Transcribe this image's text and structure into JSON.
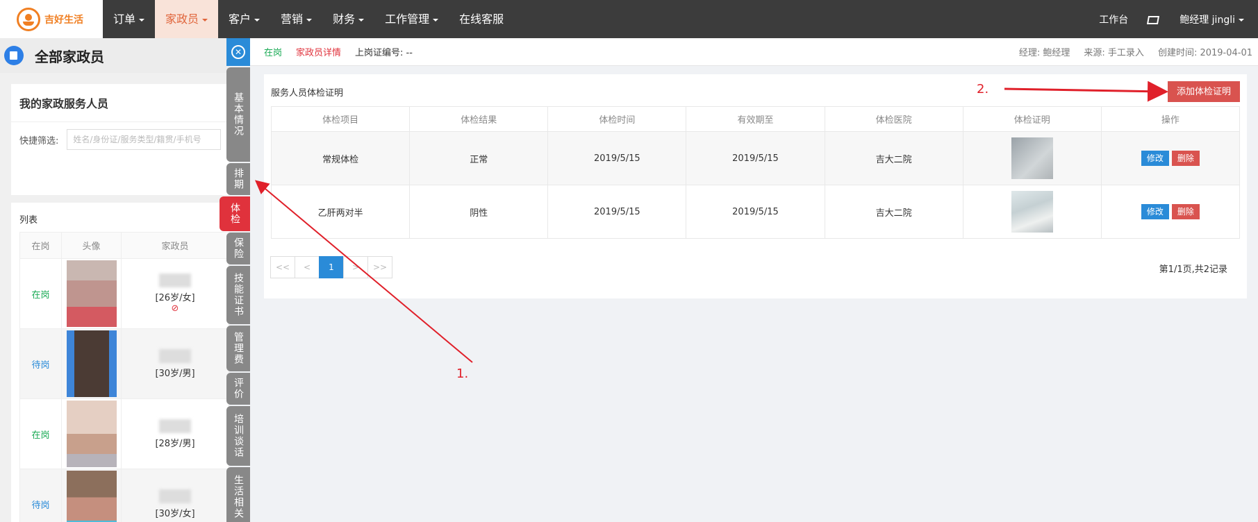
{
  "brand": {
    "name": "吉好生活",
    "accent": "#f07f22"
  },
  "nav": [
    {
      "label": "订单",
      "caret": true
    },
    {
      "label": "家政员",
      "caret": true,
      "active": true
    },
    {
      "label": "客户",
      "caret": true
    },
    {
      "label": "营销",
      "caret": true
    },
    {
      "label": "财务",
      "caret": true
    },
    {
      "label": "工作管理",
      "caret": true
    },
    {
      "label": "在线客服",
      "caret": false
    }
  ],
  "topright": {
    "workbench": "工作台",
    "user": "鲍经理  jingli"
  },
  "left": {
    "title": "全部家政员",
    "panel_title": "我的家政服务人员",
    "filter_label": "快捷筛选:",
    "filter_placeholder": "姓名/身份证/服务类型/籍贯/手机号",
    "list_title": "列表",
    "columns": [
      "在岗",
      "头像",
      "家政员"
    ],
    "rows": [
      {
        "status": "在岗",
        "status_type": "on",
        "info": "[26岁/女]",
        "banned": true
      },
      {
        "status": "待岗",
        "status_type": "wait",
        "info": "[30岁/男]",
        "banned": false
      },
      {
        "status": "在岗",
        "status_type": "on",
        "info": "[28岁/男]",
        "banned": false
      },
      {
        "status": "待岗",
        "status_type": "wait",
        "info": "[30岁/女]",
        "banned": false
      }
    ]
  },
  "vtabs": [
    "基本情况",
    "排期",
    "体检",
    "保险",
    "技能证书",
    "管理费",
    "评价",
    "培训谈话",
    "生活相关"
  ],
  "vtab_active": "体检",
  "infobar": {
    "status": "在岗",
    "detail": "家政员详情",
    "cert_no": "上岗证编号: --",
    "manager": "经理: 鲍经理",
    "source": "来源: 手工录入",
    "created": "创建时间: 2019-04-01"
  },
  "card": {
    "title": "服务人员体检证明",
    "add_button": "添加体检证明",
    "columns": [
      "体检项目",
      "体检结果",
      "体检时间",
      "有效期至",
      "体检医院",
      "体检证明",
      "操作"
    ],
    "rows": [
      {
        "item": "常规体检",
        "result": "正常",
        "date": "2019/5/15",
        "valid": "2019/5/15",
        "hospital": "吉大二院",
        "edit": "修改",
        "delete": "删除"
      },
      {
        "item": "乙肝两对半",
        "result": "阴性",
        "date": "2019/5/15",
        "valid": "2019/5/15",
        "hospital": "吉大二院",
        "edit": "修改",
        "delete": "删除"
      }
    ],
    "pager": [
      "<<",
      "<",
      "1",
      ">",
      ">>"
    ],
    "current_page": "1",
    "page_info": "第1/1页,共2记录"
  },
  "annotations": {
    "label1": "1.",
    "label2": "2.",
    "color": "#e0202a"
  }
}
